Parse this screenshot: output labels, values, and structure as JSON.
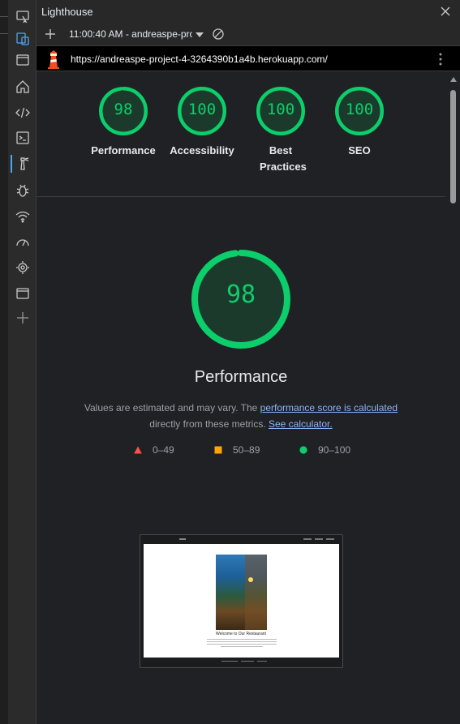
{
  "window": {
    "title": "Lighthouse",
    "report_time": "11:00:40 AM - andreaspe-pro",
    "url": "https://andreaspe-project-4-3264390b1a4b.herokuapp.com/"
  },
  "categories": [
    {
      "name": "Performance",
      "score": "98",
      "score_value": 98
    },
    {
      "name": "Accessibility",
      "score": "100",
      "score_value": 100
    },
    {
      "name": "Best Practices",
      "score": "100",
      "score_value": 100
    },
    {
      "name": "SEO",
      "score": "100",
      "score_value": 100
    }
  ],
  "performance": {
    "score": "98",
    "score_value": 98,
    "title": "Performance",
    "desc_prefix": "Values are estimated and may vary. The ",
    "desc_link1": "performance score is calculated",
    "desc_middle": "directly from these metrics. ",
    "desc_link2": "See calculator."
  },
  "legend": [
    {
      "label": "0–49",
      "shape": "triangle",
      "color": "#ff4e42"
    },
    {
      "label": "50–89",
      "shape": "square",
      "color": "#ffa400"
    },
    {
      "label": "90–100",
      "shape": "circle",
      "color": "#0cce6b"
    }
  ],
  "thumbnail": {
    "heading": "Welcome to Our Restaurant"
  },
  "colors": {
    "pass": "#0cce6b",
    "gauge_bg": "#1c3a2c",
    "link": "#8ab4f8"
  },
  "icons": {
    "activity_bar": [
      "device-emulation-icon",
      "inspect-icon",
      "window-icon",
      "home-icon",
      "elements-icon",
      "console-icon",
      "lighthouse-icon",
      "bug-icon",
      "wifi-icon",
      "performance-icon",
      "memory-icon",
      "application-icon",
      "add-icon"
    ]
  }
}
